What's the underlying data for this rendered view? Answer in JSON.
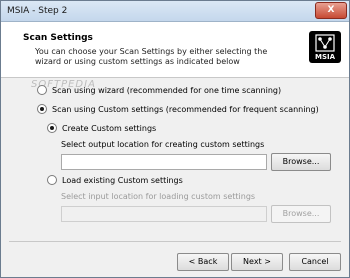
{
  "window": {
    "title": "MSIA - Step 2",
    "close_label": "X"
  },
  "header": {
    "title": "Scan Settings",
    "description": "You can choose your Scan Settings by either selecting the wizard or using custom settings as indicated below",
    "logo_text": "MSIA"
  },
  "watermark": "SOFTPEDIA",
  "options": {
    "wizard_label": "Scan using wizard (recommended for one time scanning)",
    "custom_label": "Scan using Custom settings (recommended for frequent scanning)",
    "create_label": "Create Custom settings",
    "output_prompt": "Select output location for creating custom settings",
    "output_value": "",
    "load_label": "Load existing Custom settings",
    "input_prompt": "Select input location for loading custom settings",
    "input_value": "",
    "browse_label": "Browse...",
    "browse_label_2": "Browse..."
  },
  "footer": {
    "back_label": "< Back",
    "next_label": "Next >",
    "cancel_label": "Cancel"
  }
}
